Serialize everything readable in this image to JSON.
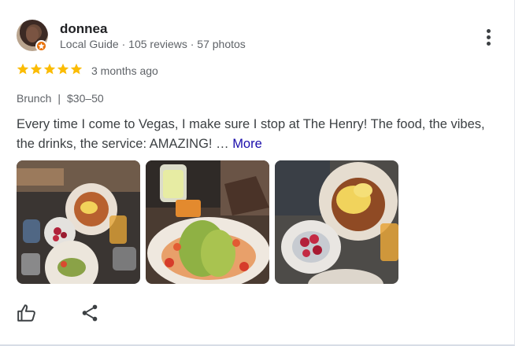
{
  "review": {
    "user_name": "donnea",
    "user_meta": "Local Guide · 105 reviews · 57 photos",
    "rating_stars": 5,
    "date": "3 months ago",
    "category": "Brunch",
    "attribute_separator": "|",
    "price": "$30–50",
    "text": "Every time I come to Vegas, I make sure I stop at The Henry! The food, the vibes, the drinks, the service: AMAZING! …",
    "more_label": "More"
  },
  "icons": {
    "menu": "more-vert-icon",
    "star": "star-icon",
    "badge": "local-guide-badge-icon",
    "like": "thumbs-up-icon",
    "share": "share-icon"
  },
  "colors": {
    "star": "#fbbc04",
    "badge": "#e8710a",
    "link": "#1a0dab"
  },
  "photos": [
    {
      "subject": "brunch-table-overview"
    },
    {
      "subject": "avocado-plate-and-drinks"
    },
    {
      "subject": "eggs-benedict-and-strawberries"
    }
  ]
}
